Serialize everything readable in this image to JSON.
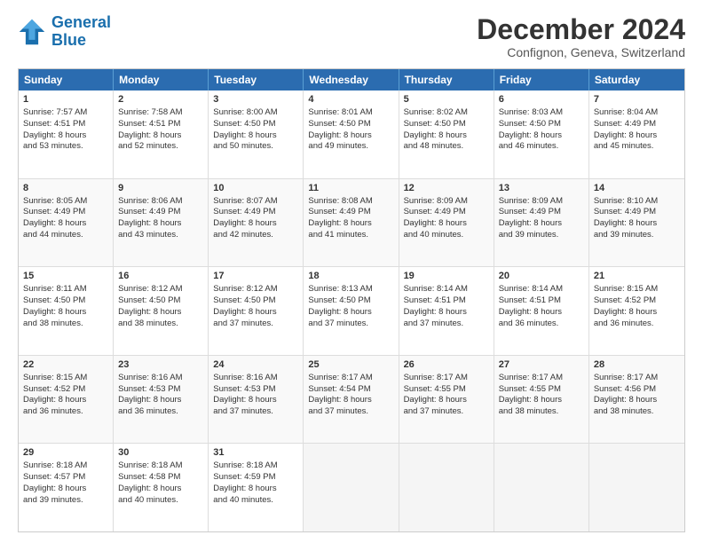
{
  "header": {
    "logo_line1": "General",
    "logo_line2": "Blue",
    "title": "December 2024",
    "subtitle": "Confignon, Geneva, Switzerland"
  },
  "weekdays": [
    "Sunday",
    "Monday",
    "Tuesday",
    "Wednesday",
    "Thursday",
    "Friday",
    "Saturday"
  ],
  "weeks": [
    [
      {
        "day": "1",
        "lines": [
          "Sunrise: 7:57 AM",
          "Sunset: 4:51 PM",
          "Daylight: 8 hours",
          "and 53 minutes."
        ]
      },
      {
        "day": "2",
        "lines": [
          "Sunrise: 7:58 AM",
          "Sunset: 4:51 PM",
          "Daylight: 8 hours",
          "and 52 minutes."
        ]
      },
      {
        "day": "3",
        "lines": [
          "Sunrise: 8:00 AM",
          "Sunset: 4:50 PM",
          "Daylight: 8 hours",
          "and 50 minutes."
        ]
      },
      {
        "day": "4",
        "lines": [
          "Sunrise: 8:01 AM",
          "Sunset: 4:50 PM",
          "Daylight: 8 hours",
          "and 49 minutes."
        ]
      },
      {
        "day": "5",
        "lines": [
          "Sunrise: 8:02 AM",
          "Sunset: 4:50 PM",
          "Daylight: 8 hours",
          "and 48 minutes."
        ]
      },
      {
        "day": "6",
        "lines": [
          "Sunrise: 8:03 AM",
          "Sunset: 4:50 PM",
          "Daylight: 8 hours",
          "and 46 minutes."
        ]
      },
      {
        "day": "7",
        "lines": [
          "Sunrise: 8:04 AM",
          "Sunset: 4:49 PM",
          "Daylight: 8 hours",
          "and 45 minutes."
        ]
      }
    ],
    [
      {
        "day": "8",
        "lines": [
          "Sunrise: 8:05 AM",
          "Sunset: 4:49 PM",
          "Daylight: 8 hours",
          "and 44 minutes."
        ]
      },
      {
        "day": "9",
        "lines": [
          "Sunrise: 8:06 AM",
          "Sunset: 4:49 PM",
          "Daylight: 8 hours",
          "and 43 minutes."
        ]
      },
      {
        "day": "10",
        "lines": [
          "Sunrise: 8:07 AM",
          "Sunset: 4:49 PM",
          "Daylight: 8 hours",
          "and 42 minutes."
        ]
      },
      {
        "day": "11",
        "lines": [
          "Sunrise: 8:08 AM",
          "Sunset: 4:49 PM",
          "Daylight: 8 hours",
          "and 41 minutes."
        ]
      },
      {
        "day": "12",
        "lines": [
          "Sunrise: 8:09 AM",
          "Sunset: 4:49 PM",
          "Daylight: 8 hours",
          "and 40 minutes."
        ]
      },
      {
        "day": "13",
        "lines": [
          "Sunrise: 8:09 AM",
          "Sunset: 4:49 PM",
          "Daylight: 8 hours",
          "and 39 minutes."
        ]
      },
      {
        "day": "14",
        "lines": [
          "Sunrise: 8:10 AM",
          "Sunset: 4:49 PM",
          "Daylight: 8 hours",
          "and 39 minutes."
        ]
      }
    ],
    [
      {
        "day": "15",
        "lines": [
          "Sunrise: 8:11 AM",
          "Sunset: 4:50 PM",
          "Daylight: 8 hours",
          "and 38 minutes."
        ]
      },
      {
        "day": "16",
        "lines": [
          "Sunrise: 8:12 AM",
          "Sunset: 4:50 PM",
          "Daylight: 8 hours",
          "and 38 minutes."
        ]
      },
      {
        "day": "17",
        "lines": [
          "Sunrise: 8:12 AM",
          "Sunset: 4:50 PM",
          "Daylight: 8 hours",
          "and 37 minutes."
        ]
      },
      {
        "day": "18",
        "lines": [
          "Sunrise: 8:13 AM",
          "Sunset: 4:50 PM",
          "Daylight: 8 hours",
          "and 37 minutes."
        ]
      },
      {
        "day": "19",
        "lines": [
          "Sunrise: 8:14 AM",
          "Sunset: 4:51 PM",
          "Daylight: 8 hours",
          "and 37 minutes."
        ]
      },
      {
        "day": "20",
        "lines": [
          "Sunrise: 8:14 AM",
          "Sunset: 4:51 PM",
          "Daylight: 8 hours",
          "and 36 minutes."
        ]
      },
      {
        "day": "21",
        "lines": [
          "Sunrise: 8:15 AM",
          "Sunset: 4:52 PM",
          "Daylight: 8 hours",
          "and 36 minutes."
        ]
      }
    ],
    [
      {
        "day": "22",
        "lines": [
          "Sunrise: 8:15 AM",
          "Sunset: 4:52 PM",
          "Daylight: 8 hours",
          "and 36 minutes."
        ]
      },
      {
        "day": "23",
        "lines": [
          "Sunrise: 8:16 AM",
          "Sunset: 4:53 PM",
          "Daylight: 8 hours",
          "and 36 minutes."
        ]
      },
      {
        "day": "24",
        "lines": [
          "Sunrise: 8:16 AM",
          "Sunset: 4:53 PM",
          "Daylight: 8 hours",
          "and 37 minutes."
        ]
      },
      {
        "day": "25",
        "lines": [
          "Sunrise: 8:17 AM",
          "Sunset: 4:54 PM",
          "Daylight: 8 hours",
          "and 37 minutes."
        ]
      },
      {
        "day": "26",
        "lines": [
          "Sunrise: 8:17 AM",
          "Sunset: 4:55 PM",
          "Daylight: 8 hours",
          "and 37 minutes."
        ]
      },
      {
        "day": "27",
        "lines": [
          "Sunrise: 8:17 AM",
          "Sunset: 4:55 PM",
          "Daylight: 8 hours",
          "and 38 minutes."
        ]
      },
      {
        "day": "28",
        "lines": [
          "Sunrise: 8:17 AM",
          "Sunset: 4:56 PM",
          "Daylight: 8 hours",
          "and 38 minutes."
        ]
      }
    ],
    [
      {
        "day": "29",
        "lines": [
          "Sunrise: 8:18 AM",
          "Sunset: 4:57 PM",
          "Daylight: 8 hours",
          "and 39 minutes."
        ]
      },
      {
        "day": "30",
        "lines": [
          "Sunrise: 8:18 AM",
          "Sunset: 4:58 PM",
          "Daylight: 8 hours",
          "and 40 minutes."
        ]
      },
      {
        "day": "31",
        "lines": [
          "Sunrise: 8:18 AM",
          "Sunset: 4:59 PM",
          "Daylight: 8 hours",
          "and 40 minutes."
        ]
      },
      {
        "day": "",
        "lines": []
      },
      {
        "day": "",
        "lines": []
      },
      {
        "day": "",
        "lines": []
      },
      {
        "day": "",
        "lines": []
      }
    ]
  ]
}
